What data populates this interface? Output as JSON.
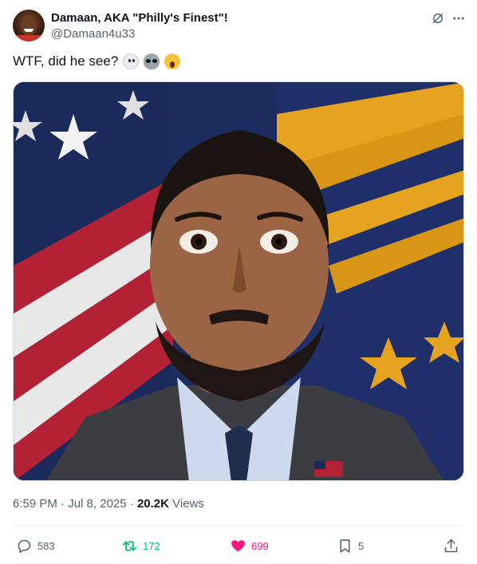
{
  "author": {
    "display_name": "Damaan, AKA \"Philly's Finest\"!",
    "handle": "@Damaan4u33"
  },
  "tweet": {
    "text": "WTF, did he see?",
    "emojis": [
      "ghost-emoji",
      "alien-emoji",
      "screaming-face-emoji"
    ]
  },
  "meta": {
    "time": "6:59 PM",
    "separator1": "·",
    "date": "Jul 8, 2025",
    "separator2": "·",
    "views_count": "20.2K",
    "views_label": "Views"
  },
  "actions": {
    "replies": "583",
    "retweets": "172",
    "likes": "699",
    "bookmarks": "5"
  },
  "colors": {
    "text_primary": "#0f1419",
    "text_secondary": "#536471",
    "retweet_active": "#00ba7c",
    "like_active": "#f91880",
    "border": "#cfd9de"
  },
  "icons": {
    "header": [
      "grok-icon",
      "more-icon"
    ],
    "actions": [
      "reply-icon",
      "retweet-icon",
      "heart-icon",
      "bookmark-icon",
      "share-icon"
    ]
  }
}
